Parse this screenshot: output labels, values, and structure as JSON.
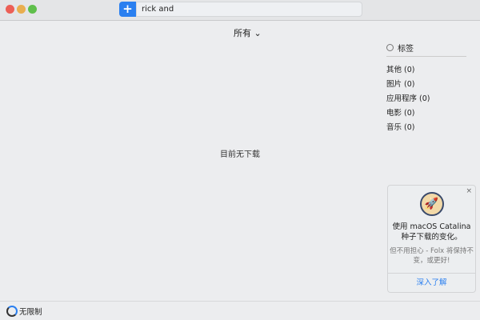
{
  "toolbar": {
    "add_label": "+",
    "search_value": "rick and"
  },
  "filter": {
    "label": "所有 ⌄"
  },
  "sidebar": {
    "header": "标签",
    "items": [
      {
        "label": "其他 (0)"
      },
      {
        "label": "图片 (0)"
      },
      {
        "label": "应用程序 (0)"
      },
      {
        "label": "电影 (0)"
      },
      {
        "label": "音乐 (0)"
      }
    ]
  },
  "main": {
    "empty_text": "目前无下载"
  },
  "promo": {
    "close": "×",
    "title": "使用 macOS Catalina 种子下载的变化。",
    "body": "但不用担心 - Folx 将保持不变，或更好!",
    "link": "深入了解"
  },
  "footer": {
    "speed_label": "无限制"
  }
}
